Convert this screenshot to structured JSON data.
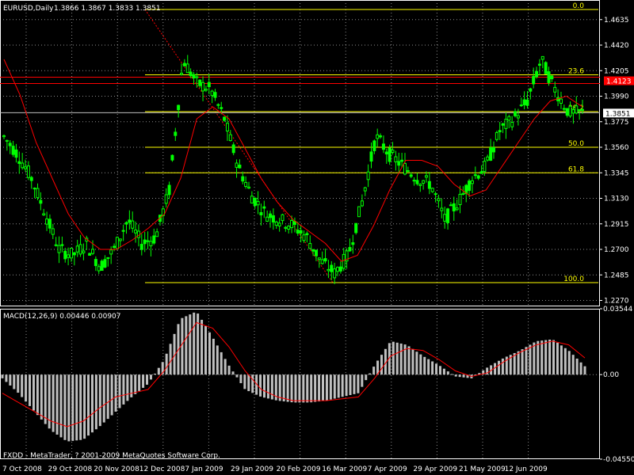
{
  "window": {
    "symbol_label": "EURUSD,Daily",
    "ohlc_label": "1.3866 1.3867 1.3833 1.3851",
    "copyright": "FXDD - MetaTrader, ? 2001-2009 MetaQuotes Software Corp."
  },
  "colors": {
    "background": "#000000",
    "grid": "#ffffff",
    "text": "#ffffff",
    "candle": "#00ff00",
    "ma": "#ff0000",
    "fib": "#ffff00",
    "hline": "#ff0000",
    "macd_hist": "#c0c0c0",
    "signal": "#ff0000"
  },
  "chart_data": [
    {
      "type": "candlestick",
      "title": "EURUSD,Daily",
      "ylim": [
        1.222,
        1.48
      ],
      "y_ticks": [
        1.4635,
        1.442,
        1.4205,
        1.399,
        1.3775,
        1.356,
        1.3345,
        1.313,
        1.2915,
        1.27,
        1.2485,
        1.227
      ],
      "x_ticks": [
        "7 Oct 2008",
        "29 Oct 2008",
        "20 Nov 2008",
        "12 Dec 2008",
        "7 Jan 2009",
        "29 Jan 2009",
        "20 Feb 2009",
        "16 Mar 2009",
        "7 Apr 2009",
        "29 Apr 2009",
        "21 May 2009",
        "12 Jun 2009"
      ],
      "close_path": [
        1.365,
        1.35,
        1.33,
        1.3,
        1.27,
        1.265,
        1.275,
        1.255,
        1.27,
        1.295,
        1.275,
        1.28,
        1.32,
        1.43,
        1.41,
        1.405,
        1.38,
        1.34,
        1.315,
        1.3,
        1.295,
        1.29,
        1.28,
        1.26,
        1.25,
        1.265,
        1.31,
        1.365,
        1.35,
        1.34,
        1.33,
        1.325,
        1.295,
        1.31,
        1.33,
        1.34,
        1.37,
        1.38,
        1.395,
        1.43,
        1.405,
        1.385,
        1.3851
      ],
      "ma_path": [
        1.43,
        1.4,
        1.36,
        1.33,
        1.3,
        1.28,
        1.27,
        1.27,
        1.278,
        1.288,
        1.3,
        1.33,
        1.38,
        1.39,
        1.38,
        1.355,
        1.33,
        1.31,
        1.295,
        1.285,
        1.275,
        1.26,
        1.265,
        1.29,
        1.32,
        1.345,
        1.345,
        1.34,
        1.325,
        1.315,
        1.32,
        1.34,
        1.36,
        1.38,
        1.395,
        1.399,
        1.39
      ],
      "current_price": 1.3851,
      "current_price_label": "1.3851",
      "red_line": 1.4123,
      "red_line_label": "1.4123",
      "fib_levels": [
        {
          "label": "0.0",
          "value": 1.472
        },
        {
          "label": "23.6",
          "value": 1.417
        },
        {
          "label": "38.2",
          "value": 1.386
        },
        {
          "label": "50.0",
          "value": 1.356
        },
        {
          "label": "61.8",
          "value": 1.3345
        },
        {
          "label": "100.0",
          "value": 1.242
        }
      ],
      "fib_trendline": [
        {
          "x": "12 Dec 2008",
          "y": 1.472
        },
        {
          "x": "20 Feb 2009",
          "y": 1.242
        }
      ]
    },
    {
      "type": "bar",
      "title": "MACD(12,26,9) 0.00446 0.00907",
      "ylim": [
        -0.0455,
        0.03544
      ],
      "y_ticks": [
        0.03544,
        0.0,
        -0.0455
      ],
      "y_tick_labels": [
        "0.03544",
        "0.00",
        "-0.04550"
      ],
      "macd_path": [
        -0.002,
        -0.01,
        -0.02,
        -0.03,
        -0.036,
        -0.035,
        -0.028,
        -0.02,
        -0.012,
        -0.005,
        0.008,
        0.03,
        0.034,
        0.02,
        0.005,
        -0.008,
        -0.012,
        -0.014,
        -0.015,
        -0.015,
        -0.014,
        -0.012,
        -0.01,
        0.005,
        0.018,
        0.016,
        0.01,
        0.005,
        -0.001,
        -0.002,
        0.004,
        0.009,
        0.013,
        0.018,
        0.019,
        0.013,
        0.0045
      ],
      "signal_path": [
        -0.01,
        -0.015,
        -0.02,
        -0.025,
        -0.028,
        -0.025,
        -0.018,
        -0.012,
        -0.01,
        -0.008,
        0.002,
        0.015,
        0.028,
        0.025,
        0.015,
        0.002,
        -0.008,
        -0.012,
        -0.014,
        -0.014,
        -0.014,
        -0.013,
        -0.012,
        -0.002,
        0.01,
        0.014,
        0.013,
        0.008,
        0.002,
        -0.001,
        0.001,
        0.007,
        0.012,
        0.016,
        0.018,
        0.016,
        0.009
      ],
      "macd_value": 0.00446,
      "signal_value": 0.00907
    }
  ]
}
